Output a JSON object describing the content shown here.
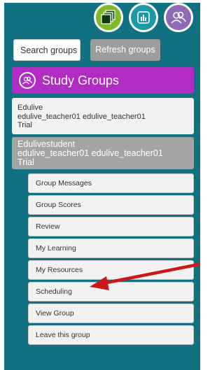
{
  "toolbar": {
    "icons": [
      "groups-icon",
      "chart-icon",
      "people-icon"
    ]
  },
  "search": {
    "placeholder": "Search groups"
  },
  "refresh_label": "Refresh groups",
  "study_groups": {
    "title": "Study Groups",
    "icon": "people-icon",
    "header_color": "#b12cc2"
  },
  "groups": [
    {
      "name": "Edulive",
      "owner": "edulive_teacher01 edulive_teacher01",
      "status": "Trial"
    },
    {
      "name": "Edulivestudent",
      "owner": "edulive_teacher01 edulive_teacher01",
      "status": "Trial"
    }
  ],
  "menu": [
    "Group Messages",
    "Group Scores",
    "Review",
    "My Learning",
    "My Resources",
    "Scheduling",
    "View Group",
    "Leave this group"
  ],
  "colors": {
    "panel": "#127180",
    "accent_green": "#7fba25",
    "accent_purple": "#b12cc2",
    "arrow": "#cc1818"
  }
}
